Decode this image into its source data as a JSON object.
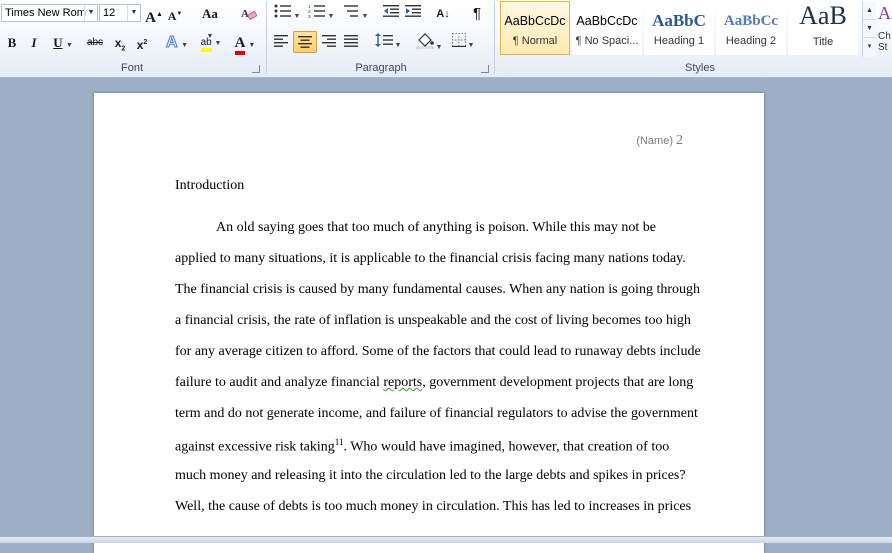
{
  "ribbon": {
    "font_group": {
      "label": "Font",
      "font_name": "Times New Rom",
      "font_size": "12",
      "grow_font": "A",
      "shrink_font": "A",
      "change_case": "Aa",
      "bold": "B",
      "italic": "I",
      "underline": "U",
      "strikethrough": "abc",
      "subscript": "x",
      "subscript_mark": "2",
      "superscript": "x",
      "superscript_mark": "2",
      "text_effects": "A",
      "highlight": "ab",
      "font_color": "A",
      "highlight_color": "#ffff00",
      "font_color_value": "#e00000"
    },
    "paragraph_group": {
      "label": "Paragraph",
      "pilcrow": "¶",
      "sort_glyph": "A↓",
      "alignment_selected": "center"
    },
    "styles_group": {
      "label": "Styles",
      "items": [
        {
          "sample": "AaBbCcDc",
          "name": "¶ Normal"
        },
        {
          "sample": "AaBbCcDc",
          "name": "¶ No Spaci..."
        },
        {
          "sample": "AaBbC",
          "name": "Heading 1"
        },
        {
          "sample": "AaBbCc",
          "name": "Heading 2"
        },
        {
          "sample": "AaB",
          "name": "Title"
        }
      ],
      "edge_glyph": "A",
      "edge_label_1": "Ch",
      "edge_label_2": "St"
    }
  },
  "document": {
    "header_name": "(Name)",
    "header_page": "2",
    "heading": "Introduction",
    "lines": [
      "An old saying goes that too much of anything is poison. While this may not be",
      "applied to many situations, it is applicable to the financial crisis facing many nations today.",
      "The financial crisis is caused by many fundamental causes. When any nation is going through",
      "a financial crisis, the rate of inflation is unspeakable and the cost of living becomes too high",
      "for any average citizen to afford. Some of the factors that could lead to runaway debts include"
    ],
    "line6_a": "failure to audit and analyze financial ",
    "line6_b": "reports",
    "line6_c": ", government development projects that are long",
    "line7": "term and do not generate income, and failure of financial regulators to advise the government",
    "line8_a": "against excessive risk taking",
    "line8_sup": "11",
    "line8_b": ". Who would have imagined, however, that creation of too",
    "line9": "much money and releasing it into the circulation led to the large debts and spikes in prices?",
    "line10": "Well, the cause of debts is too much money in circulation. This has led to increases in prices"
  }
}
